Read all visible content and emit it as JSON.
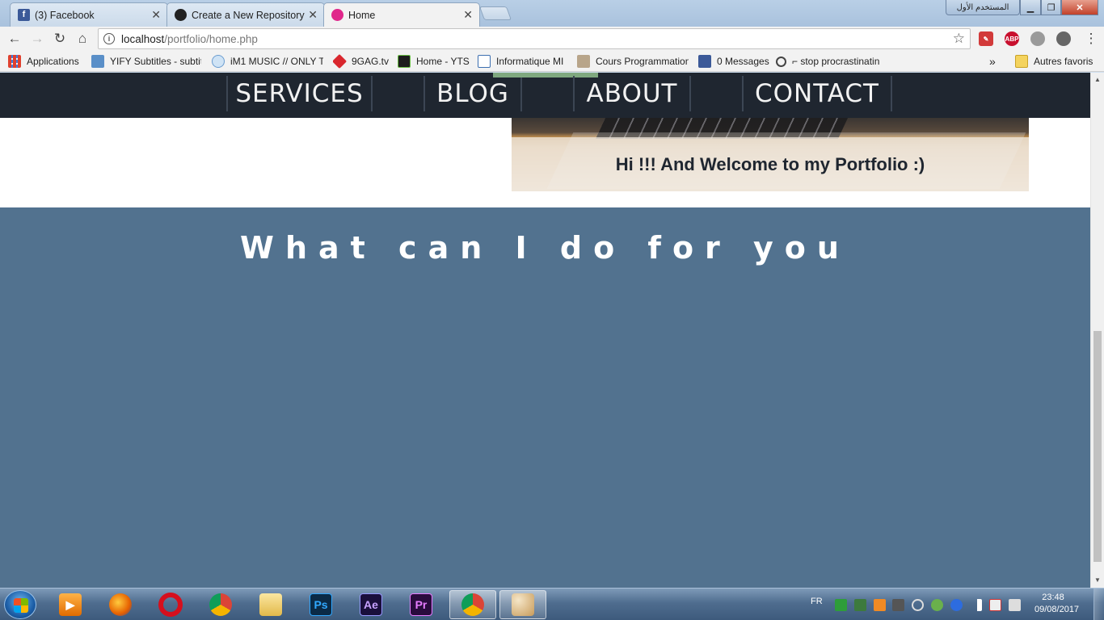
{
  "browser": {
    "tabs": [
      {
        "label": "(3) Facebook",
        "icon": "facebook-icon"
      },
      {
        "label": "Create a New Repository",
        "icon": "github-icon"
      },
      {
        "label": "Home",
        "icon": "site-icon"
      }
    ],
    "user_label": "المستخدم الأول",
    "url_host": "localhost",
    "url_path": "/portfolio/home.php",
    "bookmarks": [
      {
        "label": "Applications",
        "icon": "apps-grid-icon"
      },
      {
        "label": "YIFY Subtitles - subtit",
        "icon": "yify-icon"
      },
      {
        "label": "iM1 MUSIC // ONLY T",
        "icon": "music-icon"
      },
      {
        "label": "9GAG.tv",
        "icon": "9gag-icon"
      },
      {
        "label": "Home - YTS",
        "icon": "yts-icon"
      },
      {
        "label": "Informatique MI",
        "icon": "page-icon"
      },
      {
        "label": "Cours Programmation",
        "icon": "course-icon"
      },
      {
        "label": "0 Messages",
        "icon": "facebook-icon"
      },
      {
        "label": "⌐ stop procrastinatin",
        "icon": "link-icon"
      }
    ],
    "overflow_label": "»",
    "other_bookmarks": "Autres favoris"
  },
  "site": {
    "nav": [
      "SERVICES",
      "BLOG",
      "ABOUT",
      "CONTACT"
    ],
    "hero_caption": "Hi !!! And Welcome to my Portfolio :)",
    "section_title": "What can I do for you"
  },
  "taskbar": {
    "language": "FR",
    "time": "23:48",
    "date": "09/08/2017"
  },
  "colors": {
    "nav_bg": "#1f2630",
    "section_bg": "#52728f",
    "nav_active_accent": "#7fa87f"
  }
}
